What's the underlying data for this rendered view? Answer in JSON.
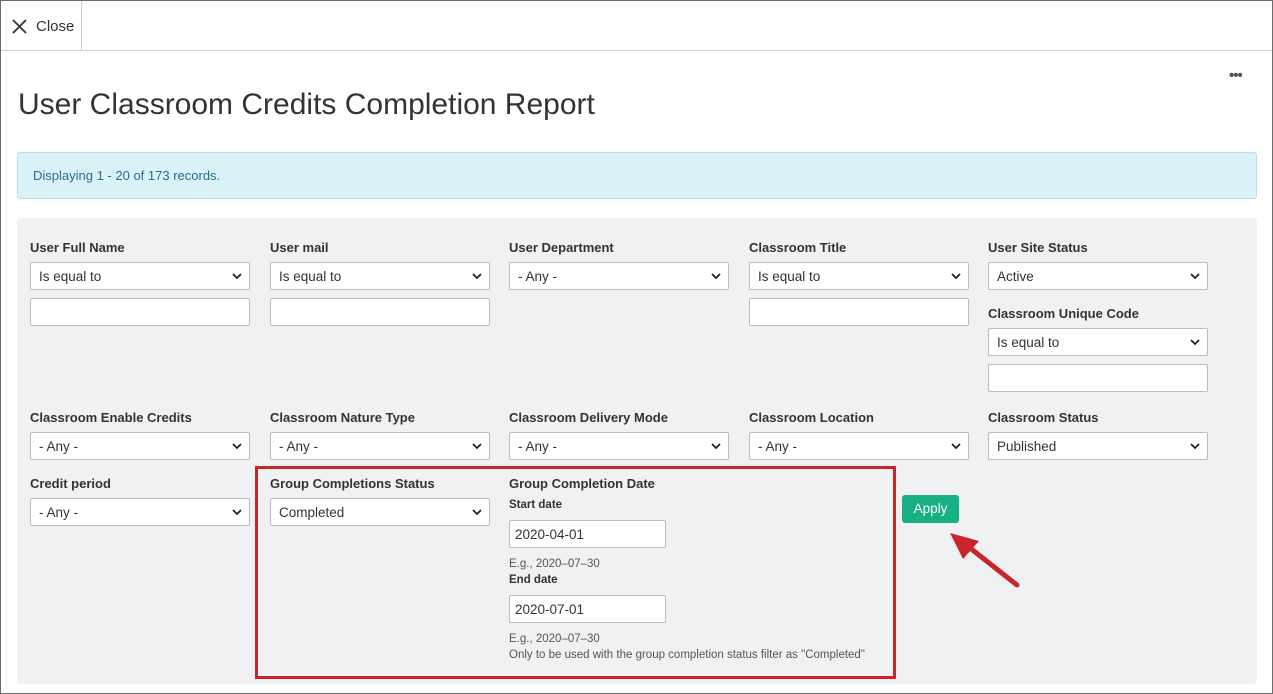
{
  "topbar": {
    "close_label": "Close"
  },
  "page": {
    "title": "User Classroom Credits Completion Report"
  },
  "alert": {
    "text": "Displaying 1 - 20 of 173 records."
  },
  "filters": {
    "user_full_name": {
      "label": "User Full Name",
      "operator": "Is equal to",
      "value": ""
    },
    "user_mail": {
      "label": "User mail",
      "operator": "Is equal to",
      "value": ""
    },
    "user_department": {
      "label": "User Department",
      "value": "- Any -"
    },
    "classroom_title": {
      "label": "Classroom Title",
      "operator": "Is equal to",
      "value": ""
    },
    "user_site_status": {
      "label": "User Site Status",
      "value": "Active"
    },
    "classroom_unique_code": {
      "label": "Classroom Unique Code",
      "operator": "Is equal to",
      "value": ""
    },
    "classroom_enable_credits": {
      "label": "Classroom Enable Credits",
      "value": "- Any -"
    },
    "classroom_nature_type": {
      "label": "Classroom Nature Type",
      "value": "- Any -"
    },
    "classroom_delivery_mode": {
      "label": "Classroom Delivery Mode",
      "value": "- Any -"
    },
    "classroom_location": {
      "label": "Classroom Location",
      "value": "- Any -"
    },
    "classroom_status": {
      "label": "Classroom Status",
      "value": "Published"
    },
    "credit_period": {
      "label": "Credit period",
      "value": "- Any -"
    },
    "group_completions_status": {
      "label": "Group Completions Status",
      "value": "Completed"
    },
    "group_completion_date": {
      "label": "Group Completion Date",
      "start_label": "Start date",
      "start_value": "2020-04-01",
      "start_hint": "E.g., 2020–07–30",
      "end_label": "End date",
      "end_value": "2020-07-01",
      "end_hint": "E.g., 2020–07–30",
      "note": "Only to be used with the group completion status filter as \"Completed\""
    },
    "apply_label": "Apply"
  },
  "colors": {
    "apply": "#17b084",
    "highlight": "#c9262c",
    "alert_bg": "#d9f1f7"
  },
  "icons": {
    "close": "close-icon",
    "more": "more-icon",
    "chevron": "chevron-down-icon",
    "arrow": "annotation-arrow-icon"
  }
}
